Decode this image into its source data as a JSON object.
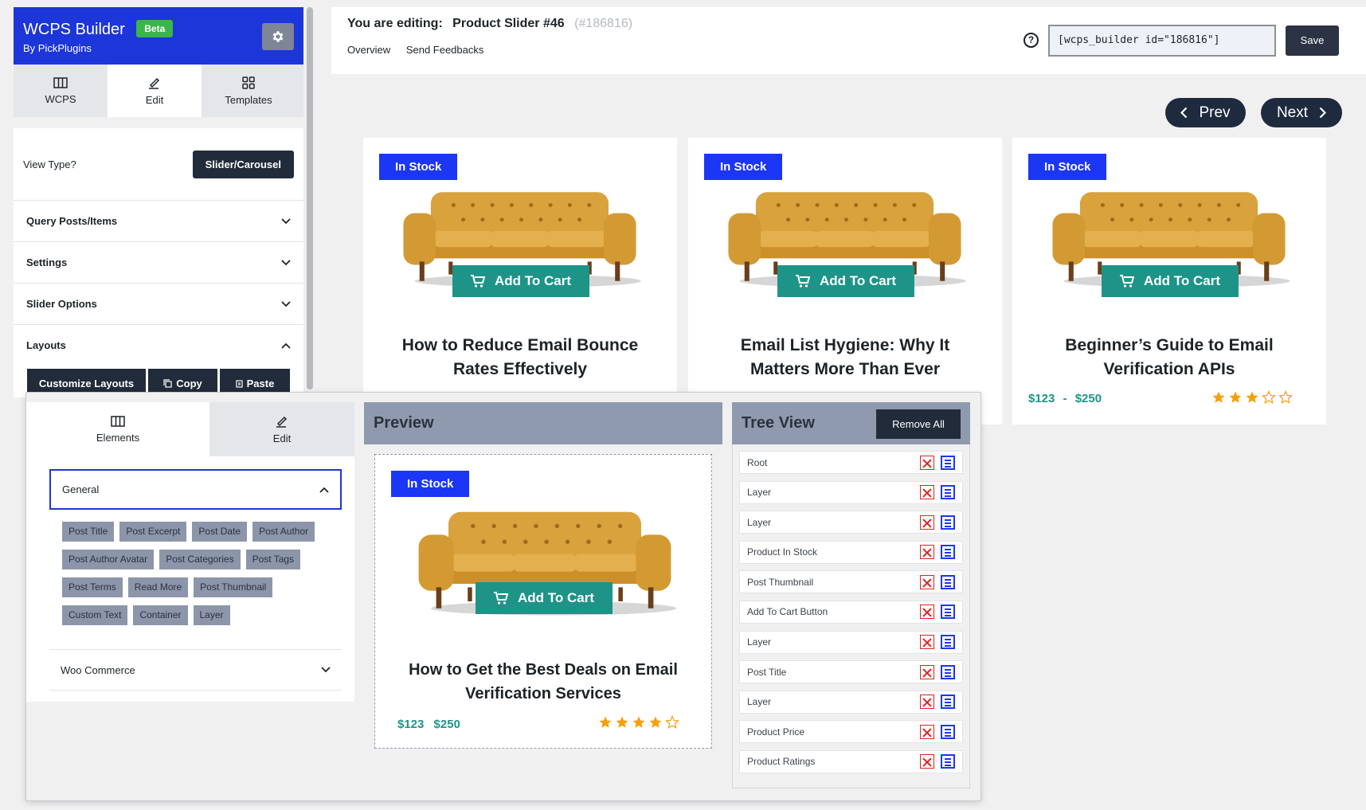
{
  "sidebar": {
    "app_title": "WCPS Builder",
    "beta_badge": "Beta",
    "byline": "By PickPlugins",
    "icons": {
      "settings": "gear-icon",
      "wcps": "columns-icon",
      "edit": "pencil-icon",
      "templates": "grid-icon"
    },
    "tabs": [
      {
        "label": "WCPS",
        "active": false
      },
      {
        "label": "Edit",
        "active": true
      },
      {
        "label": "Templates",
        "active": false
      }
    ],
    "view_type_label": "View Type?",
    "view_type_value": "Slider/Carousel",
    "accordions": [
      {
        "label": "Query Posts/Items",
        "open": false
      },
      {
        "label": "Settings",
        "open": false
      },
      {
        "label": "Slider Options",
        "open": false
      },
      {
        "label": "Layouts",
        "open": true
      }
    ],
    "layout_buttons": {
      "customize": "Customize Layouts",
      "copy": "Copy",
      "paste": "Paste"
    }
  },
  "topbar": {
    "editing_label": "You are editing:",
    "editing_name": "Product Slider #46",
    "editing_id": "(#186816)",
    "links": [
      "Overview",
      "Send Feedbacks"
    ],
    "shortcode": "[wcps_builder id=\"186816\"]",
    "save_label": "Save"
  },
  "slider_nav": {
    "prev": "Prev",
    "next": "Next"
  },
  "cards": [
    {
      "badge": "In Stock",
      "cart_label": "Add To Cart",
      "title_lines": [
        "How to Reduce Email Bounce",
        "Rates Effectively"
      ]
    },
    {
      "badge": "In Stock",
      "cart_label": "Add To Cart",
      "title_lines": [
        "Email List Hygiene: Why It",
        "Matters More Than Ever"
      ]
    },
    {
      "badge": "In Stock",
      "cart_label": "Add To Cart",
      "title_lines": [
        "Beginner’s Guide to Email",
        "Verification APIs"
      ],
      "price_min": "$123",
      "price_sep": "-",
      "price_max": "$250",
      "rating": 3,
      "rating_max": 5
    }
  ],
  "editor": {
    "tabs": [
      {
        "label": "Elements",
        "active": true
      },
      {
        "label": "Edit",
        "active": false
      }
    ],
    "general_label": "General",
    "elements": [
      "Post Title",
      "Post Excerpt",
      "Post Date",
      "Post Author",
      "Post Author Avatar",
      "Post Categories",
      "Post Tags",
      "Post Terms",
      "Read More",
      "Post Thumbnail",
      "Custom Text",
      "Container",
      "Layer"
    ],
    "woo_label": "Woo Commerce",
    "preview": {
      "heading": "Preview",
      "badge": "In Stock",
      "cart_label": "Add To Cart",
      "title_lines": [
        "How to Get the Best Deals on Email",
        "Verification Services"
      ],
      "price_min": "$123",
      "price_max": "$250",
      "rating": 4,
      "rating_max": 5
    },
    "tree": {
      "heading": "Tree View",
      "remove_all": "Remove All",
      "items": [
        "Root",
        "Layer",
        "Layer",
        "Product In Stock",
        "Post Thumbnail",
        "Add To Cart Button",
        "Layer",
        "Post Title",
        "Layer",
        "Product Price",
        "Product Ratings"
      ]
    }
  },
  "colors": {
    "brand_blue": "#1c36d9",
    "badge_blue": "#1c36f5",
    "teal": "#1e9488",
    "dark": "#222b3a",
    "star": "#f5a00a",
    "danger": "#e02020"
  }
}
